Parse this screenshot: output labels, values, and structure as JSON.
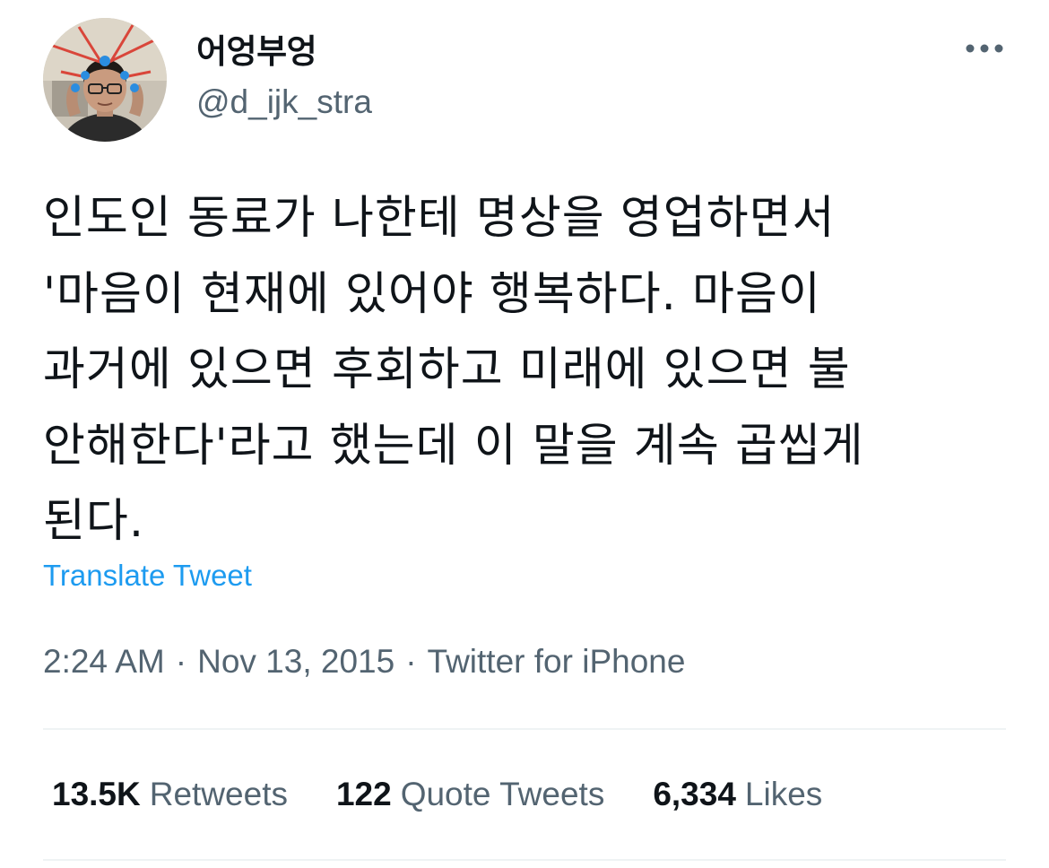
{
  "user": {
    "display_name": "어엉부엉",
    "handle": "@d_ijk_stra",
    "avatar_icon": "profile-photo"
  },
  "menu": {
    "more_icon": "ellipsis-icon"
  },
  "tweet": {
    "text": "인도인 동료가 나한테 명상을 영업하면서\n'마음이 현재에 있어야 행복하다. 마음이\n과거에 있으면 후회하고 미래에 있으면 불\n안해한다'라고 했는데 이 말을 계속 곱씹게\n된다.",
    "translate_label": "Translate Tweet"
  },
  "meta": {
    "time": "2:24 AM",
    "separator": "·",
    "date": "Nov 13, 2015",
    "source": "Twitter for iPhone"
  },
  "stats": [
    {
      "value": "13.5K",
      "label": "Retweets"
    },
    {
      "value": "122",
      "label": "Quote Tweets"
    },
    {
      "value": "6,334",
      "label": "Likes"
    }
  ],
  "colors": {
    "link": "#1d9bf0",
    "secondary_text": "#536471",
    "primary_text": "#0f1419",
    "divider": "#eff3f4"
  }
}
